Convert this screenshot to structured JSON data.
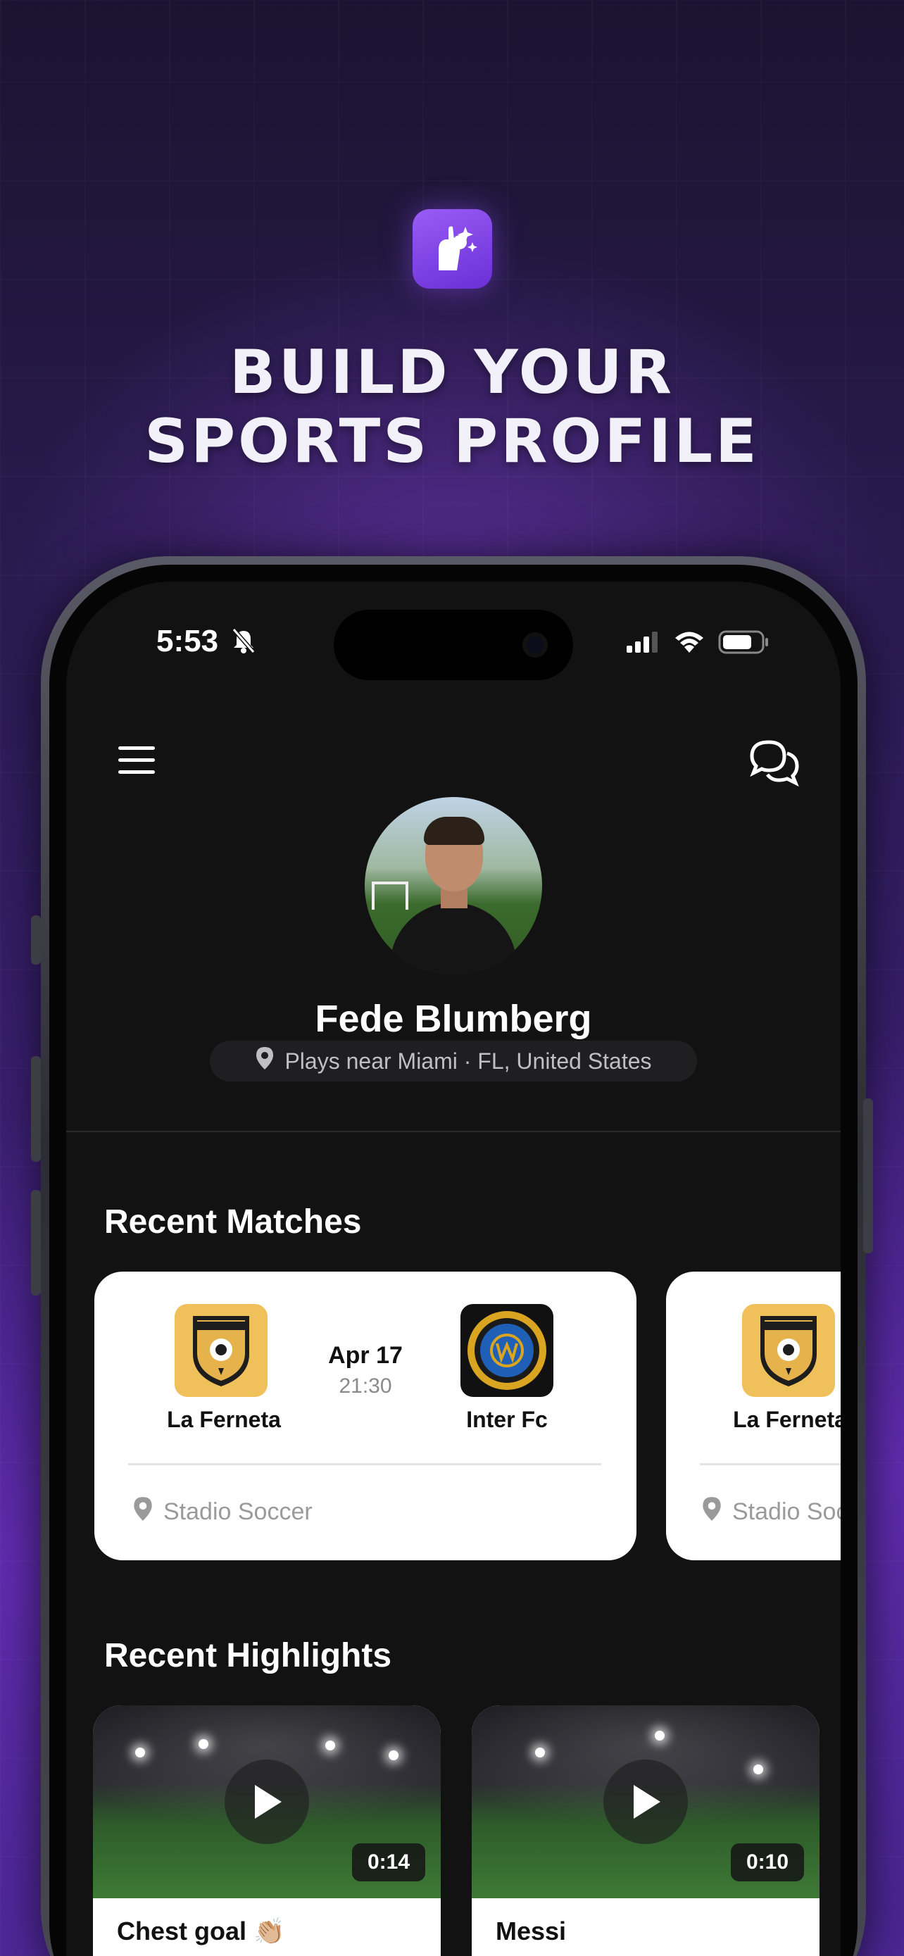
{
  "headline": {
    "line1": "BUILD YOUR",
    "line2": "SPORTS PROFILE"
  },
  "status_bar": {
    "time": "5:53"
  },
  "profile": {
    "name": "Fede Blumberg",
    "location": "Plays near Miami · FL, United States"
  },
  "recent_matches": {
    "title": "Recent Matches",
    "items": [
      {
        "home_team": "La Ferneta",
        "away_team": "Inter Fc",
        "date": "Apr 17",
        "time": "21:30",
        "venue": "Stadio Soccer"
      },
      {
        "home_team": "La Ferneta",
        "venue": "Stadio Soccer"
      }
    ]
  },
  "recent_highlights": {
    "title": "Recent Highlights",
    "items": [
      {
        "title": "Chest goal 👏🏼",
        "duration": "0:14"
      },
      {
        "title": "Messi",
        "duration": "0:10"
      }
    ]
  },
  "colors": {
    "brand_purple": "#7a3ce6",
    "screen_bg": "#121212",
    "card_bg": "#ffffff",
    "team_gold": "#f0c15a"
  }
}
